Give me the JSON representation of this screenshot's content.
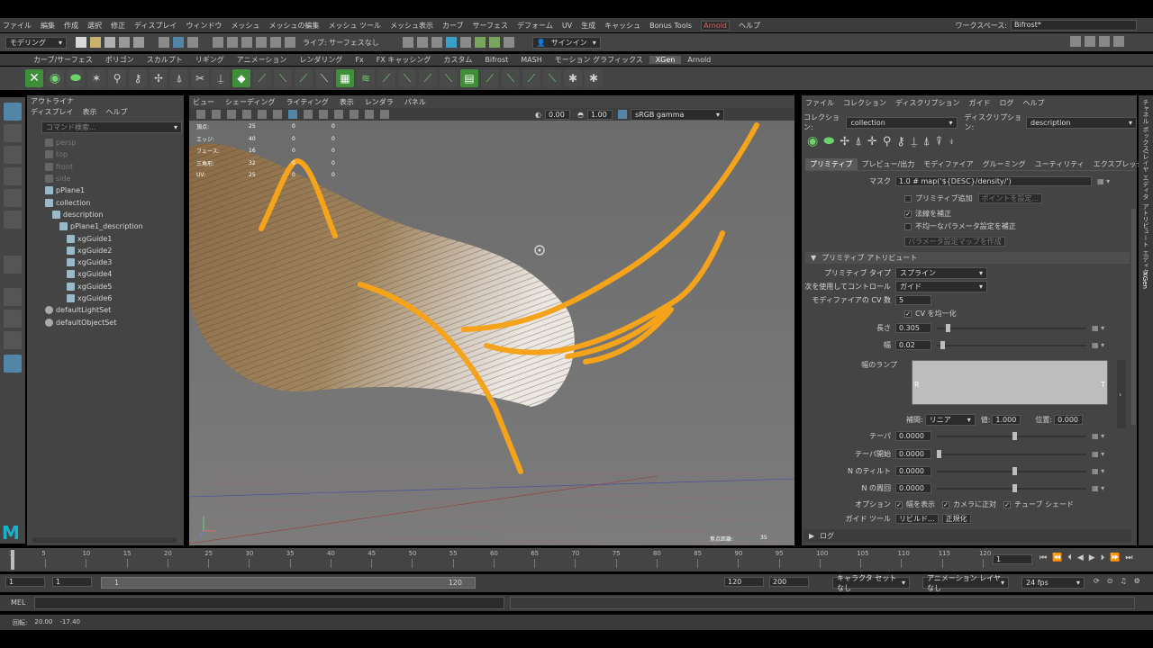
{
  "menubar": {
    "items": [
      "ファイル",
      "編集",
      "作成",
      "選択",
      "修正",
      "ディスプレイ",
      "ウィンドウ",
      "メッシュ",
      "メッシュの編集",
      "メッシュ ツール",
      "メッシュ表示",
      "カーブ",
      "サーフェス",
      "デフォーム",
      "UV",
      "生成",
      "キャッシュ",
      "Bonus Tools",
      "Arnold",
      "ヘルプ"
    ],
    "workspace_label": "ワークスペース:",
    "workspace_value": "Bifrost*"
  },
  "statusline": {
    "mode": "モデリング",
    "live_surface": "ライブ: サーフェスなし",
    "signin": "サインイン"
  },
  "shelf": {
    "tabs": [
      "カーブ/サーフェス",
      "ポリゴン",
      "スカルプト",
      "リギング",
      "アニメーション",
      "レンダリング",
      "Fx",
      "FX キャッシング",
      "カスタム",
      "Bifrost",
      "MASH",
      "モーション グラフィックス",
      "XGen",
      "Arnold"
    ],
    "active_tab": "XGen"
  },
  "outliner": {
    "title": "アウトライナ",
    "menu": [
      "ディスプレイ",
      "表示",
      "ヘルプ"
    ],
    "search_placeholder": "コマンド検索...",
    "items": [
      {
        "label": "persp",
        "dim": true,
        "indent": 1
      },
      {
        "label": "top",
        "dim": true,
        "indent": 1
      },
      {
        "label": "front",
        "dim": true,
        "indent": 1
      },
      {
        "label": "side",
        "dim": true,
        "indent": 1
      },
      {
        "label": "pPlane1",
        "dim": false,
        "indent": 1
      },
      {
        "label": "collection",
        "dim": false,
        "indent": 1
      },
      {
        "label": "description",
        "dim": false,
        "indent": 2
      },
      {
        "label": "pPlane1_description",
        "dim": false,
        "indent": 3
      },
      {
        "label": "xgGuide1",
        "dim": false,
        "indent": 4
      },
      {
        "label": "xgGuide2",
        "dim": false,
        "indent": 4
      },
      {
        "label": "xgGuide3",
        "dim": false,
        "indent": 4
      },
      {
        "label": "xgGuide4",
        "dim": false,
        "indent": 4
      },
      {
        "label": "xgGuide5",
        "dim": false,
        "indent": 4
      },
      {
        "label": "xgGuide6",
        "dim": false,
        "indent": 4
      },
      {
        "label": "defaultLightSet",
        "dim": false,
        "indent": 1
      },
      {
        "label": "defaultObjectSet",
        "dim": false,
        "indent": 1
      }
    ]
  },
  "viewport": {
    "menu": [
      "ビュー",
      "シェーディング",
      "ライティング",
      "表示",
      "レンダラ",
      "パネル"
    ],
    "exposure": "0.00",
    "gamma": "1.00",
    "colorspace": "sRGB gamma",
    "hud": [
      {
        "label": "頂点:",
        "a": "25",
        "b": "0",
        "c": "0"
      },
      {
        "label": "エッジ:",
        "a": "40",
        "b": "0",
        "c": "0"
      },
      {
        "label": "フェース:",
        "a": "16",
        "b": "0",
        "c": "0"
      },
      {
        "label": "三角形:",
        "a": "32",
        "b": "0",
        "c": "0"
      },
      {
        "label": "UV:",
        "a": "25",
        "b": "0",
        "c": "0"
      }
    ],
    "focal_label": "焦点距離:",
    "focal_value": "35"
  },
  "xgen": {
    "menu": [
      "ファイル",
      "コレクション",
      "ディスクリプション",
      "ガイド",
      "ログ",
      "ヘルプ"
    ],
    "collection_label": "コレクション:",
    "collection_value": "collection",
    "description_label": "ディスクリプション:",
    "description_value": "description",
    "tabs": [
      "プリミティブ",
      "プレビュー/出力",
      "モディファイア",
      "グルーミング",
      "ユーティリティ",
      "エクスプレッション"
    ],
    "active_tab": "プリミティブ",
    "mask_label": "マスク",
    "mask_value": "1.0 # map('${DESC}/density/')",
    "primitive_add_label": "プリミティブ追加",
    "primitive_add_btn": "ポイントを設定...",
    "normal_fix_label": "法線を補正",
    "normal_fix_checked": true,
    "nonuniform_label": "不均一なパラメータ設定を補正",
    "param_map_btn": "パラメータ設定マップを作成",
    "section_title": "プリミティブ アトリビュート",
    "prim_type_label": "プリミティブ タイプ",
    "prim_type_value": "スプライン",
    "control_label": "次を使用してコントロール",
    "control_value": "ガイド",
    "cv_count_label": "モディファイアの CV 数",
    "cv_count_value": "5",
    "cv_uniform_label": "CV を均一化",
    "length_label": "長さ",
    "length_value": "0.305",
    "width_label": "幅",
    "width_value": "0.02",
    "ramp_label": "幅のランプ",
    "ramp_r": "R",
    "ramp_t": "T",
    "interp_label": "補間:",
    "interp_value": "リニア",
    "val_label": "値:",
    "val_value": "1.000",
    "pos_label": "位置:",
    "pos_value": "0.000",
    "taper_label": "テーパ",
    "taper_value": "0.0000",
    "taper_start_label": "テーパ開始",
    "taper_start_value": "0.0000",
    "n_tilt_label": "N のティルト",
    "n_tilt_value": "0.0000",
    "n_twist_label": "N の周回",
    "n_twist_value": "0.0000",
    "options_label": "オプション",
    "opt1": "幅を表示",
    "opt2": "カメラに正対",
    "opt3": "チューブ シェード",
    "guide_tool_label": "ガイド ツール",
    "guide_btn1": "リビルド...",
    "guide_btn2": "正規化",
    "log_label": "ログ"
  },
  "rightstrip": {
    "labels": [
      "チャネル ボックス/レイヤ エディタ",
      "アトリビュート エディタ",
      "XGen"
    ]
  },
  "timeline": {
    "ticks": [
      "1",
      "5",
      "10",
      "15",
      "20",
      "25",
      "30",
      "35",
      "40",
      "45",
      "50",
      "55",
      "60",
      "65",
      "70",
      "75",
      "80",
      "85",
      "90",
      "95",
      "100",
      "105",
      "110",
      "115",
      "120"
    ],
    "current": "1"
  },
  "range": {
    "start": "1",
    "playback_start": "1",
    "slider_start": "1",
    "slider_end": "120",
    "playback_end": "120",
    "end": "200",
    "character_set": "キャラクタ セットなし",
    "anim_layer": "アニメーション レイヤなし",
    "fps": "24 fps"
  },
  "mel": {
    "label": "MEL"
  },
  "helpline": {
    "label": "回転:",
    "x": "20.00",
    "y": "-17.40"
  },
  "colors": {
    "accent_blue": "#5285a6",
    "xgen_guide": "#f5a31a",
    "xgen_tab": "#5a5a5a",
    "maya_logo": "#18b3c9"
  }
}
